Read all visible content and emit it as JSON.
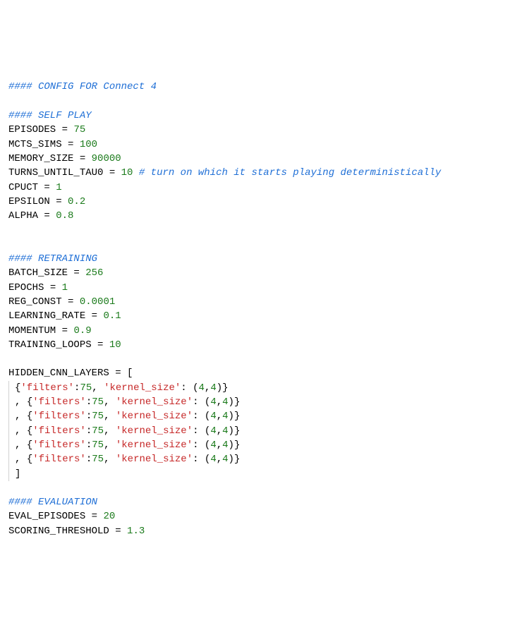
{
  "header_comment": "#### CONFIG FOR Connect 4",
  "self_play": {
    "heading": "#### SELF PLAY",
    "episodes_name": "EPISODES",
    "episodes_val": "75",
    "mcts_sims_name": "MCTS_SIMS",
    "mcts_sims_val": "100",
    "memory_size_name": "MEMORY_SIZE",
    "memory_size_val": "90000",
    "turns_until_tau0_name": "TURNS_UNTIL_TAU0",
    "turns_until_tau0_val": "10",
    "turns_until_tau0_comment": "# turn on which it starts playing deterministically",
    "cpuct_name": "CPUCT",
    "cpuct_val": "1",
    "epsilon_name": "EPSILON",
    "epsilon_val": "0.2",
    "alpha_name": "ALPHA",
    "alpha_val": "0.8"
  },
  "retraining": {
    "heading": "#### RETRAINING",
    "batch_size_name": "BATCH_SIZE",
    "batch_size_val": "256",
    "epochs_name": "EPOCHS",
    "epochs_val": "1",
    "reg_const_name": "REG_CONST",
    "reg_const_val": "0.0001",
    "learning_rate_name": "LEARNING_RATE",
    "learning_rate_val": "0.1",
    "momentum_name": "MOMENTUM",
    "momentum_val": "0.9",
    "training_loops_name": "TRAINING_LOOPS",
    "training_loops_val": "10"
  },
  "hidden_cnn": {
    "name": "HIDDEN_CNN_LAYERS",
    "filters_key": "'filters'",
    "kernel_key": "'kernel_size'",
    "filters_val": "75",
    "kernel_val_a": "4",
    "kernel_val_b": "4"
  },
  "evaluation": {
    "heading": "#### EVALUATION",
    "eval_episodes_name": "EVAL_EPISODES",
    "eval_episodes_val": "20",
    "scoring_threshold_name": "SCORING_THRESHOLD",
    "scoring_threshold_val": "1.3"
  },
  "eq": " = ",
  "colon": ":",
  "open_brace": "{",
  "close_brace": "}",
  "open_paren": "(",
  "close_paren": ")",
  "open_bracket": "[",
  "close_bracket": "]",
  "comma": ",",
  "comma_sp": ", "
}
